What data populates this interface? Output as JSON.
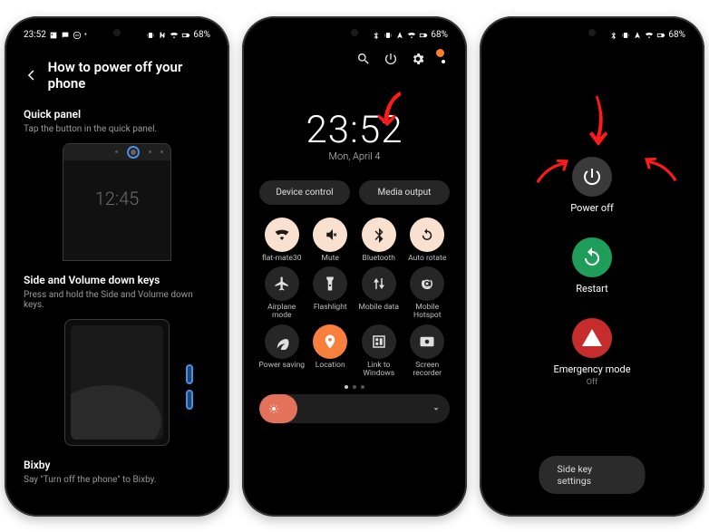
{
  "status_bar": {
    "time": "23:52",
    "battery_pct": "68%"
  },
  "phone1": {
    "title": "How to power off your phone",
    "sections": {
      "quick_panel": {
        "heading": "Quick panel",
        "desc": "Tap the button in the quick panel.",
        "mock_time": "12:45"
      },
      "side_keys": {
        "heading": "Side and Volume down keys",
        "desc": "Press and hold the Side and Volume down keys."
      },
      "bixby": {
        "heading": "Bixby",
        "desc": "Say \"Turn off the phone\" to Bixby."
      }
    }
  },
  "phone2": {
    "clock": {
      "time": "23:52",
      "date": "Mon, April 4"
    },
    "pills": {
      "device_control": "Device control",
      "media_output": "Media output"
    },
    "tiles": [
      {
        "label": "flat-mate30",
        "on": true,
        "glyph": "wifi"
      },
      {
        "label": "Mute",
        "on": true,
        "glyph": "mute"
      },
      {
        "label": "Bluetooth",
        "on": true,
        "glyph": "bluetooth"
      },
      {
        "label": "Auto rotate",
        "on": true,
        "glyph": "rotate"
      },
      {
        "label": "Airplane mode",
        "on": false,
        "glyph": "airplane"
      },
      {
        "label": "Flashlight",
        "on": false,
        "glyph": "flashlight"
      },
      {
        "label": "Mobile data",
        "on": false,
        "glyph": "mobiledata"
      },
      {
        "label": "Mobile Hotspot",
        "on": false,
        "glyph": "hotspot"
      },
      {
        "label": "Power saving",
        "on": false,
        "glyph": "leaf"
      },
      {
        "label": "Location",
        "on": true,
        "glyph": "location"
      },
      {
        "label": "Link to Windows",
        "on": false,
        "glyph": "link"
      },
      {
        "label": "Screen recorder",
        "on": false,
        "glyph": "record"
      }
    ]
  },
  "phone3": {
    "power_off": "Power off",
    "restart": "Restart",
    "emergency": {
      "label": "Emergency mode",
      "state": "Off"
    },
    "side_key_settings": "Side key settings"
  }
}
